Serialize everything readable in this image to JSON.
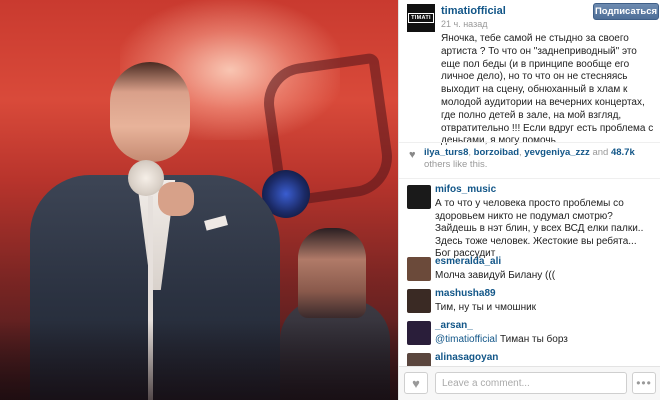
{
  "post": {
    "username": "timatiofficial",
    "avatar_text": "TIMATI",
    "time": "21 ч. назад",
    "follow_label": "Подписаться",
    "caption": "Яночка, тебе самой не стыдно за своего артиста ? То что он \"заднеприводный\" это еще пол беды (и в принципе вообще его личное дело), но то что он не стесняясь выходит на сцену, обнюханный в хлам к молодой аудитории на вечерних концертах, где полно детей в зале, на мой взгляд, отвратительно !!! Если вдруг есть проблема с деньгами, я могу помочь"
  },
  "likes": {
    "user1": "ilya_turs8",
    "sep1": ", ",
    "user2": "borzoibad",
    "sep2": ", ",
    "user3": "yevgeniya_zzz",
    "and": " and ",
    "count": "48.7k",
    "others": " others like this."
  },
  "comments": [
    {
      "user": "mifos_music",
      "text": "А то что у человека просто проблемы со здоровьем никто не подумал смотрю? Зайдешь в нэт блин, у всех ВСД елки палки.. Здесь тоже человек. Жестокие вы ребята... Бог рассудит",
      "avatar_color": "#1a1a1a"
    },
    {
      "user": "esmeralda_ali",
      "text": "Молча завидуй Билану (((",
      "avatar_color": "#6b4a3a"
    },
    {
      "user": "mashusha89",
      "text": "Тим, ну ты и чмошник",
      "avatar_color": "#3a2a24"
    },
    {
      "user": "_arsan_",
      "mention": "@timatiofficial",
      "text": " Тиман ты борз",
      "avatar_color": "#2a1e3a"
    },
    {
      "user": "alinasagoyan",
      "text": "",
      "avatar_color": "#5a463e"
    }
  ],
  "footer": {
    "heart_icon": "♥",
    "placeholder": "Leave a comment...",
    "more_icon": "•••"
  }
}
